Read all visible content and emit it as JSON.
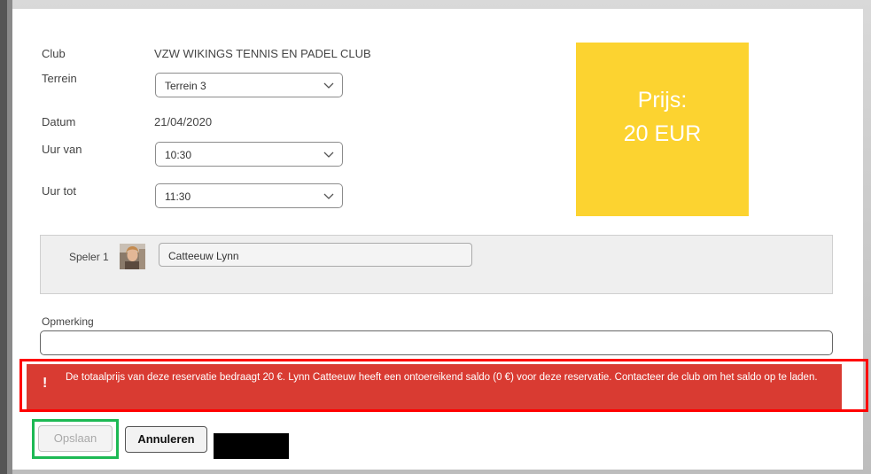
{
  "form": {
    "club_label": "Club",
    "club_value": "VZW WIKINGS TENNIS EN PADEL CLUB",
    "terrain_label": "Terrein",
    "terrain_value": "Terrein 3",
    "date_label": "Datum",
    "date_value": "21/04/2020",
    "from_label": "Uur van",
    "from_value": "10:30",
    "to_label": "Uur tot",
    "to_value": "11:30"
  },
  "price": {
    "line1": "Prijs:",
    "line2": "20 EUR",
    "color": "#fcd330"
  },
  "players": [
    {
      "label": "Speler 1",
      "name": "Catteeuw Lynn"
    }
  ],
  "remark": {
    "label": "Opmerking",
    "value": ""
  },
  "alert": {
    "icon": "!",
    "message": "De totaalprijs van deze reservatie bedraagt 20 €. Lynn Catteeuw heeft een ontoereikend saldo (0 €) voor deze reservatie. Contacteer de club om het saldo op te laden.",
    "color": "#d93b32"
  },
  "actions": {
    "save_label": "Opslaan",
    "cancel_label": "Annuleren"
  },
  "highlights": {
    "alert_frame_color": "#ff0000",
    "save_frame_color": "#1db954"
  }
}
